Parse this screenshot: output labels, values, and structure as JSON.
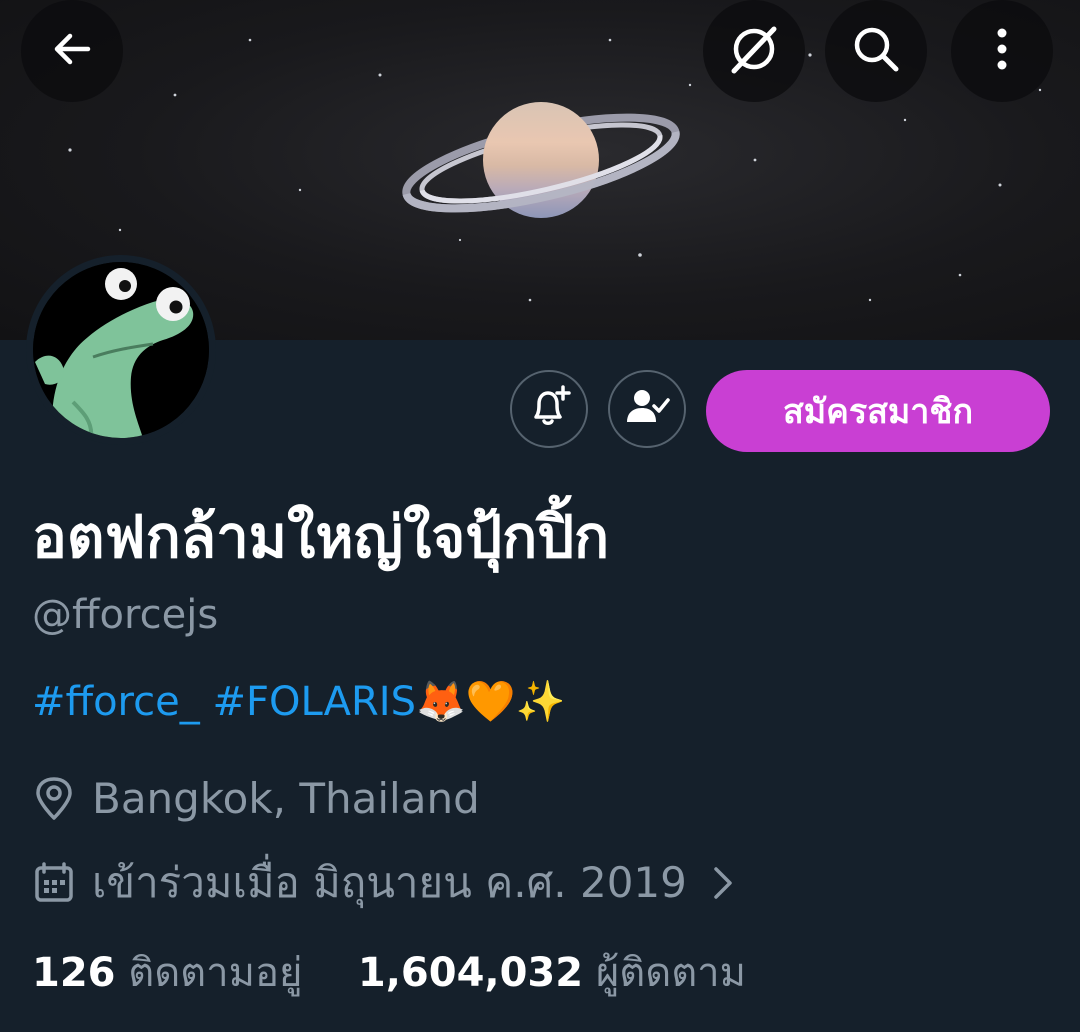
{
  "profile": {
    "display_name": "อตฟกล้ามใหญ่ใจปุ้กปิ้ก",
    "handle": "@fforcejs",
    "bio": {
      "tag1": "#fforce_",
      "tag2": "#FOLARIS",
      "emojis": "🦊🧡✨"
    },
    "location": "Bangkok, Thailand",
    "joined": "เข้าร่วมเมื่อ มิถุนายน ค.ศ. 2019",
    "following_count": "126",
    "following_label": "ติดตามอยู่",
    "followers_count": "1,604,032",
    "followers_label": "ผู้ติดตาม"
  },
  "actions": {
    "subscribe_label": "สมัครสมาชิก"
  },
  "colors": {
    "background": "#15202b",
    "link": "#1d9bf0",
    "subscribe": "#c93fd3",
    "secondary_text": "#8b98a5"
  },
  "icons": {
    "back": "arrow-left-icon",
    "grok": "grok-icon",
    "search": "search-icon",
    "more": "more-vertical-icon",
    "notify": "bell-plus-icon",
    "following": "person-check-icon",
    "location": "location-pin-icon",
    "calendar": "calendar-icon",
    "chevron": "chevron-right-icon"
  }
}
